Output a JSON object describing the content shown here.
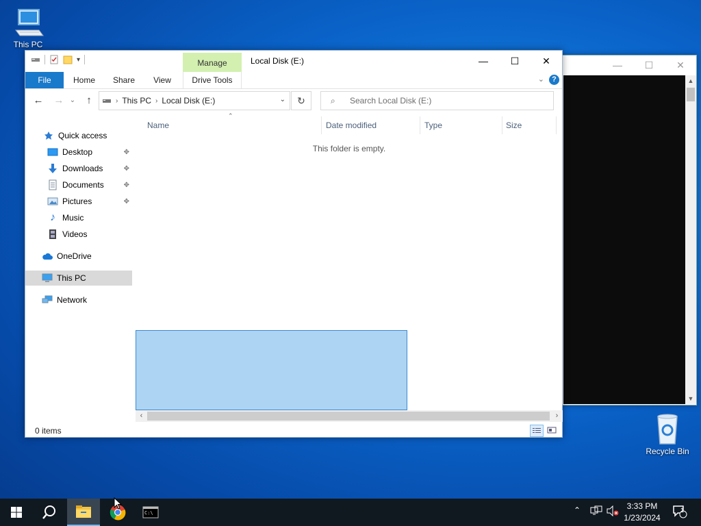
{
  "desktop": {
    "this_pc_label": "This PC",
    "recycle_bin_label": "Recycle Bin"
  },
  "explorer": {
    "title": "Local Disk (E:)",
    "contextual_tab": "Manage",
    "ribbon_tabs": {
      "file": "File",
      "home": "Home",
      "share": "Share",
      "view": "View",
      "drive_tools": "Drive Tools"
    },
    "address": {
      "segments": [
        "This PC",
        "Local Disk (E:)"
      ]
    },
    "search": {
      "placeholder": "Search Local Disk (E:)"
    },
    "nav": {
      "quick_access": "Quick access",
      "desktop": "Desktop",
      "downloads": "Downloads",
      "documents": "Documents",
      "pictures": "Pictures",
      "music": "Music",
      "videos": "Videos",
      "onedrive": "OneDrive",
      "this_pc": "This PC",
      "network": "Network"
    },
    "columns": {
      "name": "Name",
      "date_modified": "Date modified",
      "type": "Type",
      "size": "Size"
    },
    "empty_message": "This folder is empty.",
    "status": {
      "item_count": "0 items"
    }
  },
  "taskbar": {
    "time": "3:33 PM",
    "date": "1/23/2024",
    "notification_count": "1"
  },
  "colors": {
    "accent": "#1979ca",
    "manage_tab": "#d3f0b0",
    "selection": "#99c9ef",
    "taskbar": "#101820"
  }
}
